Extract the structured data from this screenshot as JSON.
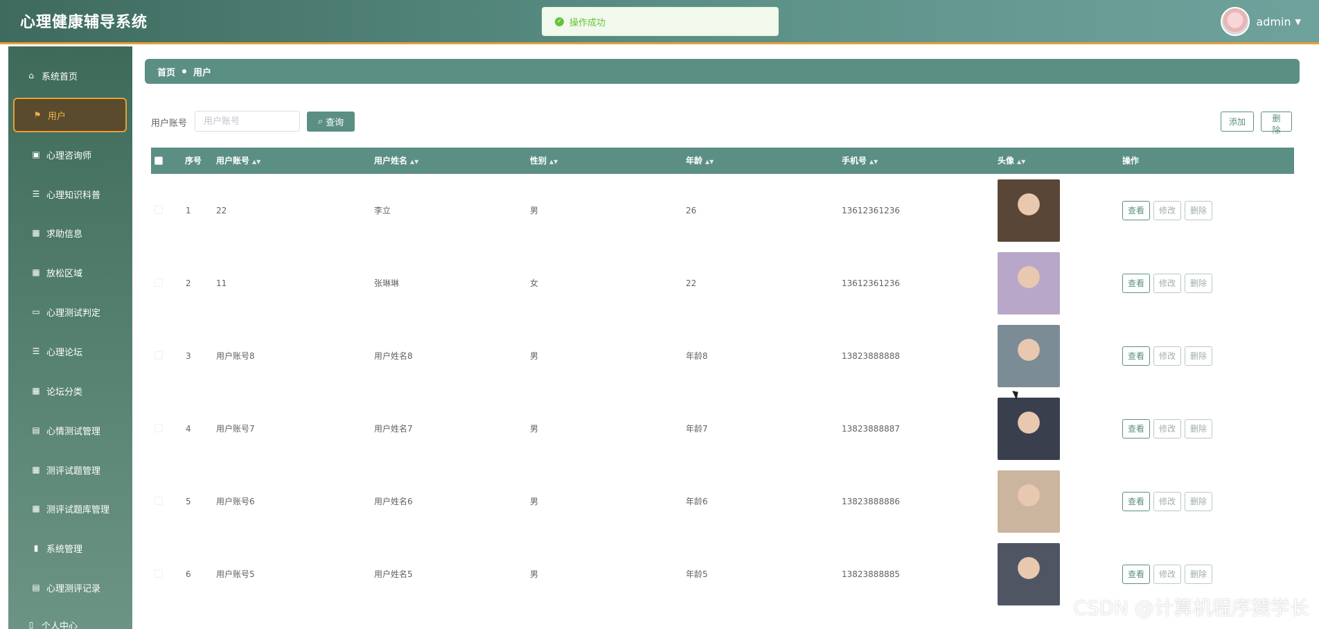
{
  "header": {
    "title": "心理健康辅导系统",
    "toast": "操作成功",
    "user": "admin"
  },
  "sidebar": {
    "items": [
      {
        "label": "系统首页",
        "icon": "home-icon"
      },
      {
        "label": "用户",
        "icon": "flag-icon",
        "active": true
      },
      {
        "label": "心理咨询师",
        "icon": "chart-icon"
      },
      {
        "label": "心理知识科普",
        "icon": "list-icon"
      },
      {
        "label": "求助信息",
        "icon": "grid-icon"
      },
      {
        "label": "放松区域",
        "icon": "grid-icon"
      },
      {
        "label": "心理测试判定",
        "icon": "monitor-icon"
      },
      {
        "label": "心理论坛",
        "icon": "list-icon"
      },
      {
        "label": "论坛分类",
        "icon": "grid-icon"
      },
      {
        "label": "心情测试管理",
        "icon": "clipboard-icon"
      },
      {
        "label": "测评试题管理",
        "icon": "grid-icon"
      },
      {
        "label": "测评试题库管理",
        "icon": "grid-icon"
      },
      {
        "label": "系统管理",
        "icon": "book-icon"
      },
      {
        "label": "心理测评记录",
        "icon": "clipboard-icon"
      },
      {
        "label": "个人中心",
        "icon": "doc-icon"
      }
    ]
  },
  "breadcrumb": {
    "home": "首页",
    "current": "用户"
  },
  "search": {
    "label": "用户账号",
    "placeholder": "用户账号",
    "button": "查询",
    "add": "添加",
    "delete": "删除"
  },
  "table": {
    "headers": [
      "序号",
      "用户账号",
      "用户姓名",
      "性别",
      "年龄",
      "手机号",
      "头像",
      "操作"
    ],
    "actions": {
      "view": "查看",
      "edit": "修改",
      "delete": "删除"
    },
    "rows": [
      {
        "no": "1",
        "account": "22",
        "name": "李立",
        "gender": "男",
        "age": "26",
        "phone": "13612361236",
        "avatar_color": "#5a4636"
      },
      {
        "no": "2",
        "account": "11",
        "name": "张琳琳",
        "gender": "女",
        "age": "22",
        "phone": "13612361236",
        "avatar_color": "#b9a7c9"
      },
      {
        "no": "3",
        "account": "用户账号8",
        "name": "用户姓名8",
        "gender": "男",
        "age": "年龄8",
        "phone": "13823888888",
        "avatar_color": "#7b8c96"
      },
      {
        "no": "4",
        "account": "用户账号7",
        "name": "用户姓名7",
        "gender": "男",
        "age": "年龄7",
        "phone": "13823888887",
        "avatar_color": "#3a3f4d"
      },
      {
        "no": "5",
        "account": "用户账号6",
        "name": "用户姓名6",
        "gender": "男",
        "age": "年龄6",
        "phone": "13823888886",
        "avatar_color": "#cbb59e"
      },
      {
        "no": "6",
        "account": "用户账号5",
        "name": "用户姓名5",
        "gender": "男",
        "age": "年龄5",
        "phone": "13823888885",
        "avatar_color": "#4f5563"
      }
    ]
  },
  "watermark": "CSDN @计算机程序猿学长"
}
